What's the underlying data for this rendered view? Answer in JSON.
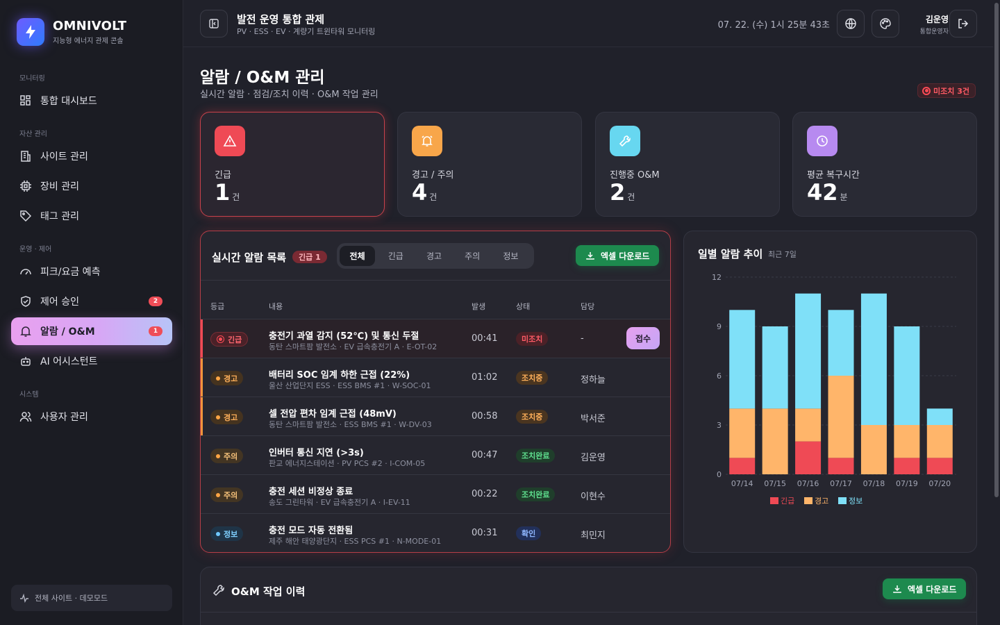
{
  "brand": {
    "name": "OMNIVOLT",
    "subtitle": "지능형 에너지 관제 콘솔"
  },
  "sidebar": {
    "sections": [
      "모니터링",
      "자산 관리",
      "운영 · 제어",
      "시스템"
    ],
    "items": [
      {
        "label": "통합 대시보드",
        "icon": "grid-icon"
      },
      {
        "label": "사이트 관리",
        "icon": "building-icon"
      },
      {
        "label": "장비 관리",
        "icon": "chip-icon"
      },
      {
        "label": "태그 관리",
        "icon": "tag-icon"
      },
      {
        "label": "피크/요금 예측",
        "icon": "gauge-icon"
      },
      {
        "label": "제어 승인",
        "icon": "shield-check-icon",
        "badge": "2"
      },
      {
        "label": "알람 / O&M",
        "icon": "bell-icon",
        "badge": "1",
        "active": true
      },
      {
        "label": "AI 어시스턴트",
        "icon": "robot-icon"
      },
      {
        "label": "사용자 관리",
        "icon": "users-icon"
      }
    ],
    "footer": "전체 사이트 · 데모모드"
  },
  "header": {
    "title": "발전 운영 통합 관제",
    "subtitle": "PV · ESS · EV · 계량기 트윈타워 모니터링",
    "clock": "07. 22. (수) 1시 25분 43초",
    "user_name": "김운영",
    "user_role": "통합운영자"
  },
  "page": {
    "title": "알람 / O&M 관리",
    "subtitle": "실시간 알람 · 점검/조치 이력 · O&M 작업 관리",
    "unack_badge": "미조치 3건"
  },
  "stats": [
    {
      "label": "긴급",
      "value": "1",
      "unit": "건",
      "color": "#ef4a55"
    },
    {
      "label": "경고 / 주의",
      "value": "4",
      "unit": "건",
      "color": "#f8a64a"
    },
    {
      "label": "진행중 O&M",
      "value": "2",
      "unit": "건",
      "color": "#67d7f0"
    },
    {
      "label": "평균 복구시간",
      "value": "42",
      "unit": "분",
      "color": "#b78af0"
    }
  ],
  "alarms": {
    "title": "실시간 알람 목록",
    "badge": "긴급 1",
    "tabs": [
      "전체",
      "긴급",
      "경고",
      "주의",
      "정보"
    ],
    "excel_label": "엑셀 다운로드",
    "columns": [
      "등급",
      "내용",
      "발생",
      "상태",
      "담당"
    ],
    "ack_label": "접수",
    "rows": [
      {
        "sev": "긴급",
        "title": "충전기 과열 감지 (52℃) 및 통신 두절",
        "desc": "동탄 스마트팜 발전소 · EV 급속충전기 A · E-OT-02",
        "time": "00:41",
        "status": "미조치",
        "owner": "-"
      },
      {
        "sev": "경고",
        "title": "배터리 SOC 임계 하한 근접 (22%)",
        "desc": "울산 산업단지 ESS · ESS BMS #1 · W-SOC-01",
        "time": "01:02",
        "status": "조치중",
        "owner": "정하늘"
      },
      {
        "sev": "경고",
        "title": "셀 전압 편차 임계 근접 (48mV)",
        "desc": "동탄 스마트팜 발전소 · ESS BMS #1 · W-DV-03",
        "time": "00:58",
        "status": "조치중",
        "owner": "박서준"
      },
      {
        "sev": "주의",
        "title": "인버터 통신 지연 (>3s)",
        "desc": "판교 에너지스테이션 · PV PCS #2 · I-COM-05",
        "time": "00:47",
        "status": "조치완료",
        "owner": "김운영"
      },
      {
        "sev": "주의",
        "title": "충전 세션 비정상 종료",
        "desc": "송도 그린타워 · EV 급속충전기 A · I-EV-11",
        "time": "00:22",
        "status": "조치완료",
        "owner": "이현수"
      },
      {
        "sev": "정보",
        "title": "충전 모드 자동 전환됨",
        "desc": "제주 해안 태양광단지 · ESS PCS #1 · N-MODE-01",
        "time": "00:31",
        "status": "확인",
        "owner": "최민지"
      }
    ]
  },
  "chart_data": {
    "type": "bar",
    "stacked": true,
    "title": "일별 알람 추이",
    "subtitle": "최근 7일",
    "categories": [
      "07/14",
      "07/15",
      "07/16",
      "07/17",
      "07/18",
      "07/19",
      "07/20"
    ],
    "series": [
      {
        "name": "긴급",
        "color": "#ef4a55",
        "values": [
          1,
          0,
          2,
          1,
          0,
          1,
          1
        ]
      },
      {
        "name": "경고",
        "color": "#ffb56a",
        "values": [
          3,
          4,
          2,
          5,
          3,
          2,
          2
        ]
      },
      {
        "name": "정보",
        "color": "#7fe0f8",
        "values": [
          6,
          5,
          7,
          4,
          8,
          6,
          1
        ]
      }
    ],
    "yticks": [
      0,
      3,
      6,
      9,
      12
    ],
    "ylim": [
      0,
      12
    ],
    "grid": true,
    "legend": "bottom"
  },
  "om": {
    "title": "O&M 작업 이력",
    "excel_label": "엑셀 다운로드"
  }
}
